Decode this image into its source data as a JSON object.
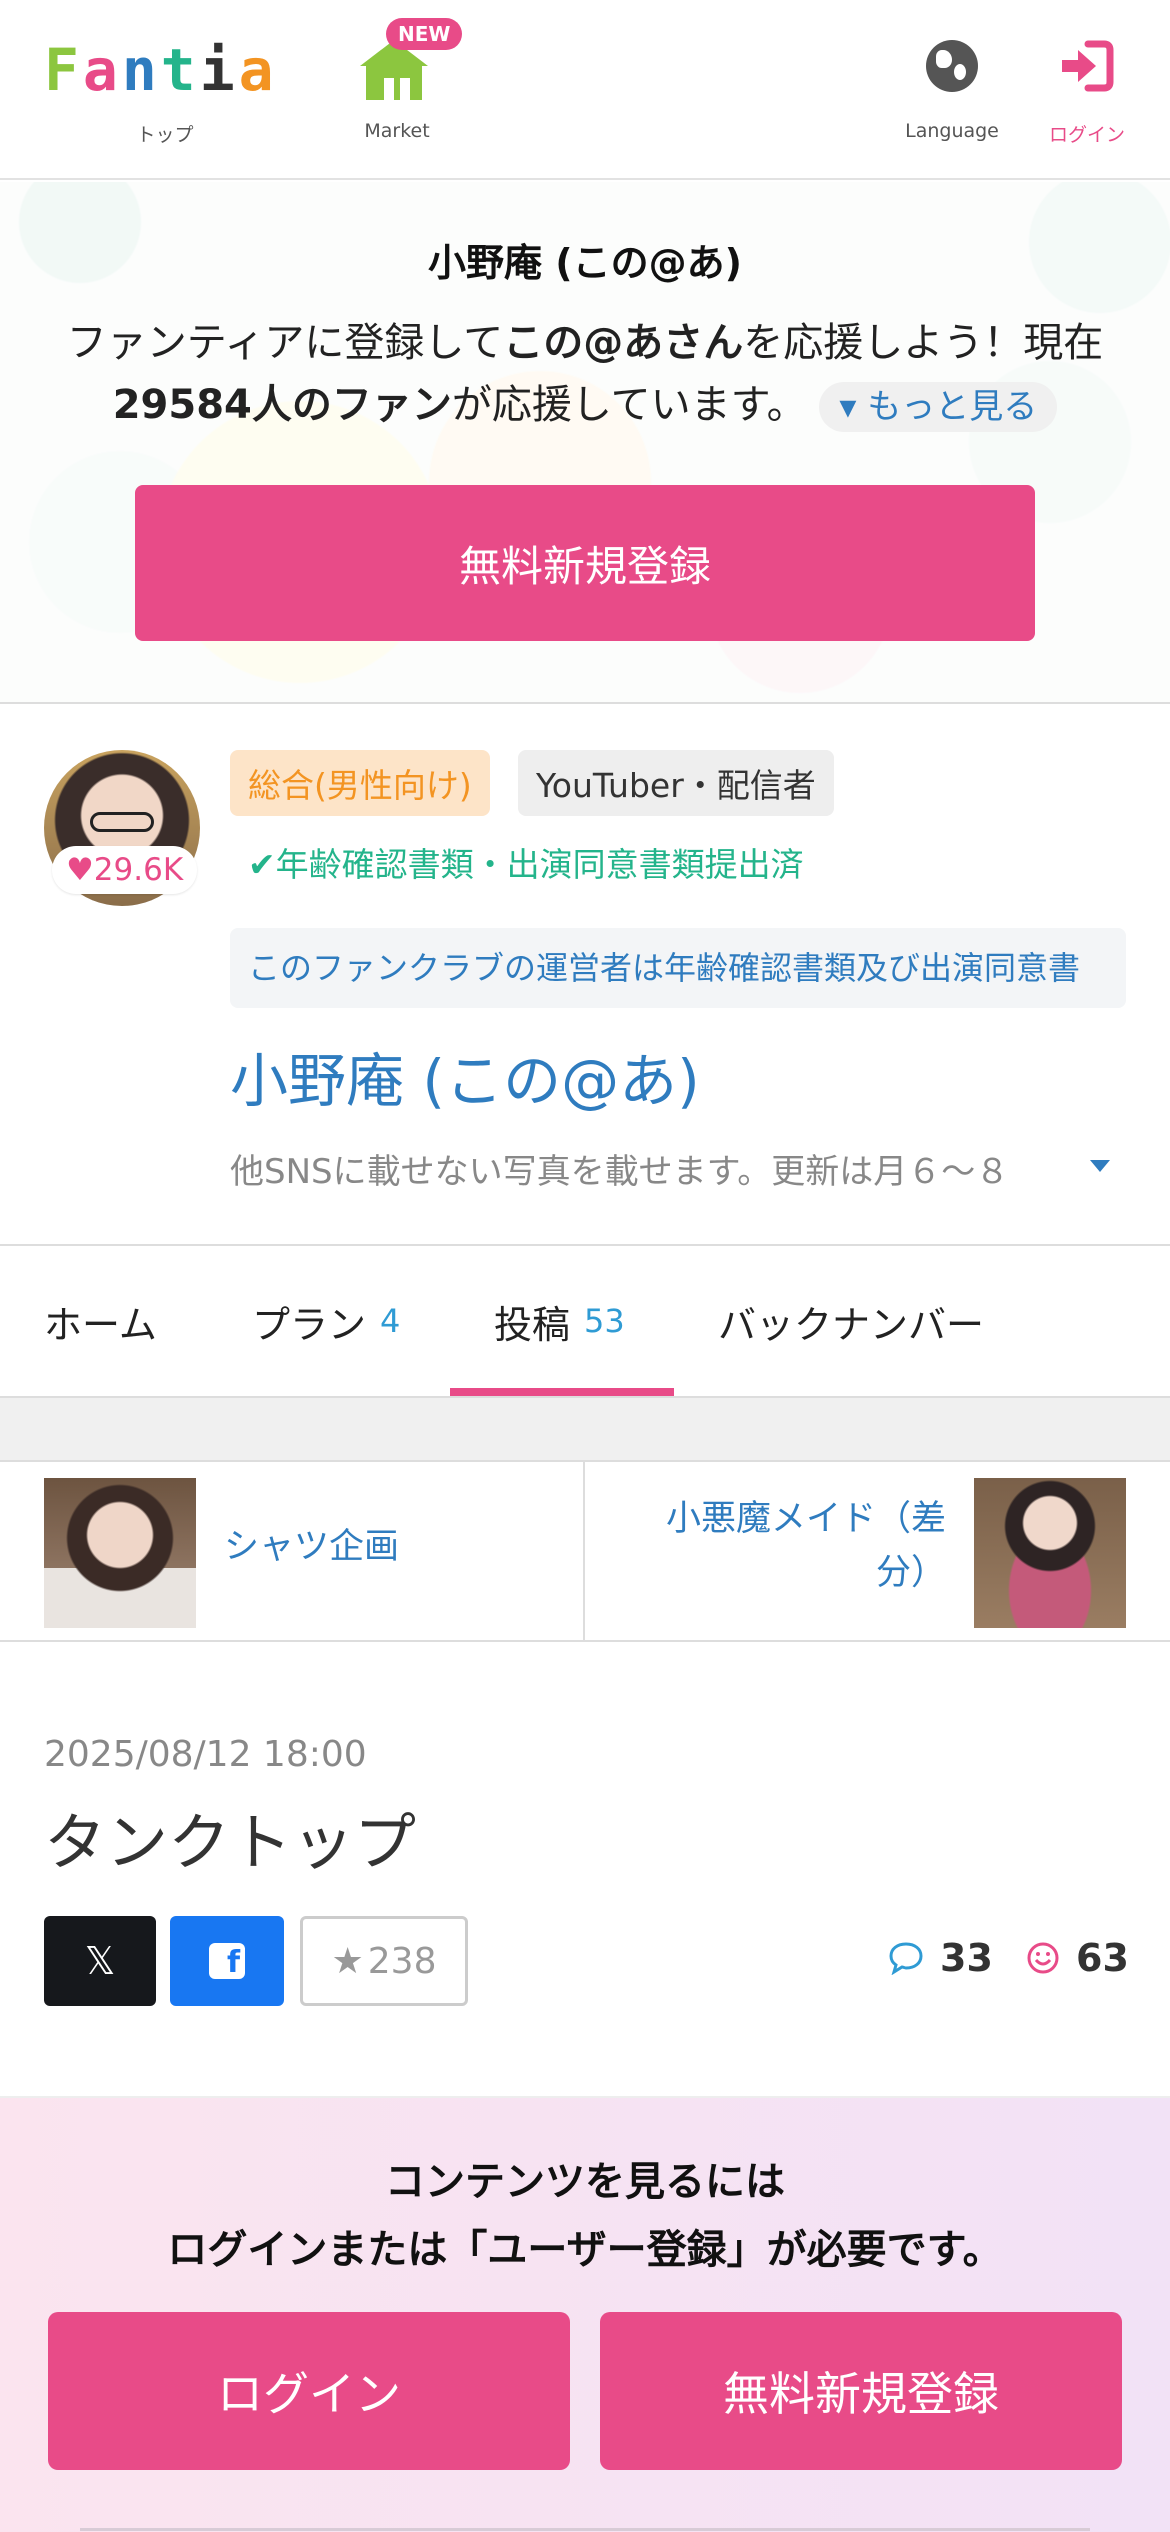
{
  "header": {
    "logo": [
      "F",
      "a",
      "n",
      "t",
      "i",
      "a"
    ],
    "logo_colors": [
      "#8cc63f",
      "#e84b88",
      "#2f7cbf",
      "#24b48b",
      "#333333",
      "#f39422"
    ],
    "top_label": "トップ",
    "market_label": "Market",
    "market_badge": "NEW",
    "language_label": "Language",
    "login_label": "ログイン",
    "icons": {
      "top": "fantia-logo",
      "market": "shop-icon",
      "language": "globe-icon",
      "login": "sign-in-icon"
    }
  },
  "hero": {
    "title": "小野庵 (この@あ)",
    "text_part1": "ファンティアに登録して",
    "text_bold1": "この@あさん",
    "text_part2": "を応援しよう！現在",
    "text_bold2": "29584人のファン",
    "text_part3": "が応援しています。",
    "more_label": "もっと見る",
    "register_label": "無料新規登録"
  },
  "profile": {
    "fan_count": "29.6K",
    "category_tag": "総合(男性向け)",
    "type_tag": "YouTuber・配信者",
    "verified": "年齢確認書類・出演同意書類提出済",
    "notice": "このファンクラブの運営者は年齢確認書類及び出演同意書",
    "name": "小野庵 (この@あ)",
    "description": "他SNSに載せない写真を載せます。更新は月６〜８"
  },
  "tabs": [
    {
      "label": "ホーム",
      "count": ""
    },
    {
      "label": "プラン",
      "count": "4"
    },
    {
      "label": "投稿",
      "count": "53"
    },
    {
      "label": "バックナンバー",
      "count": ""
    }
  ],
  "active_tab": "投稿",
  "prev_next": {
    "prev_title": "シャツ企画",
    "next_title": "小悪魔メイド（差分）"
  },
  "post": {
    "date": "2025/08/12 18:00",
    "title": "タンクトップ",
    "x_label": "𝕏",
    "fb_label": "f",
    "fav_count": "238",
    "comment_count": "33",
    "reaction_count": "63"
  },
  "login_prompt": {
    "line1": "コンテンツを見るには",
    "line2": "ログインまたは「ユーザー登録」が必要です。",
    "login_label": "ログイン",
    "register_label": "無料新規登録"
  },
  "colors": {
    "accent": "#e84b88",
    "link": "#2f7cbf",
    "verified": "#24b48b",
    "category": "#f39422"
  }
}
